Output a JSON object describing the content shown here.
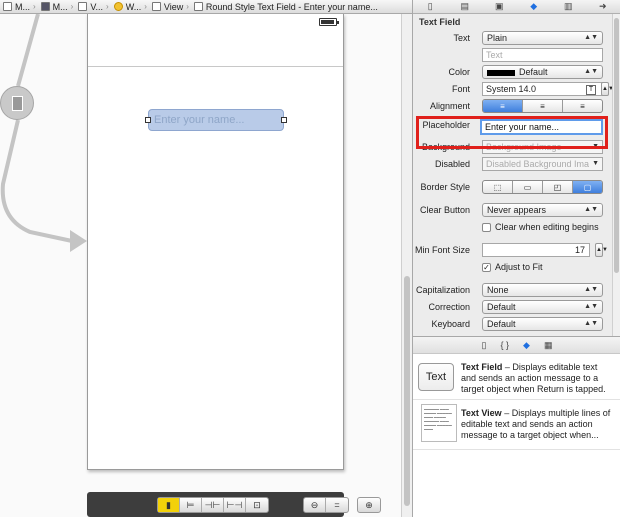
{
  "breadcrumb": [
    {
      "label": "M...",
      "icon": "project-icon"
    },
    {
      "label": "M...",
      "icon": "folder-icon"
    },
    {
      "label": "V...",
      "icon": "storyboard-icon"
    },
    {
      "label": "W...",
      "icon": "view-controller-icon"
    },
    {
      "label": "View",
      "icon": "view-icon"
    },
    {
      "label": "Round Style Text Field - Enter your name...",
      "icon": "text-field-icon"
    }
  ],
  "canvas": {
    "text_field_placeholder": "Enter your name..."
  },
  "inspector": {
    "section_title": "Text Field",
    "text": {
      "label": "Text",
      "value": "Plain",
      "field_placeholder": "Text"
    },
    "color": {
      "label": "Color",
      "value": "Default",
      "swatch_color": "#000000"
    },
    "font": {
      "label": "Font",
      "value": "System 14.0"
    },
    "alignment": {
      "label": "Alignment"
    },
    "placeholder": {
      "label": "Placeholder",
      "value": "Enter your name..."
    },
    "background": {
      "label": "Background",
      "value": "Background Image"
    },
    "disabled": {
      "label": "Disabled",
      "value": "Disabled Background Ima"
    },
    "border_style": {
      "label": "Border Style"
    },
    "clear_button": {
      "label": "Clear Button",
      "value": "Never appears"
    },
    "clear_when_editing": {
      "label": "Clear when editing begins",
      "checked": false
    },
    "min_font_size": {
      "label": "Min Font Size",
      "value": "17"
    },
    "adjust_to_fit": {
      "label": "Adjust to Fit",
      "checked": true
    },
    "capitalization": {
      "label": "Capitalization",
      "value": "None"
    },
    "correction": {
      "label": "Correction",
      "value": "Default"
    },
    "keyboard": {
      "label": "Keyboard",
      "value": "Default"
    }
  },
  "library": [
    {
      "thumb": "Text",
      "name": "Text Field",
      "desc": " – Displays editable text and sends an action message to a target object when Return is tapped."
    },
    {
      "name": "Text View",
      "desc": " – Displays multiple lines of editable text and sends an action message to a target object when..."
    }
  ],
  "highlight_color": "#e0201b"
}
